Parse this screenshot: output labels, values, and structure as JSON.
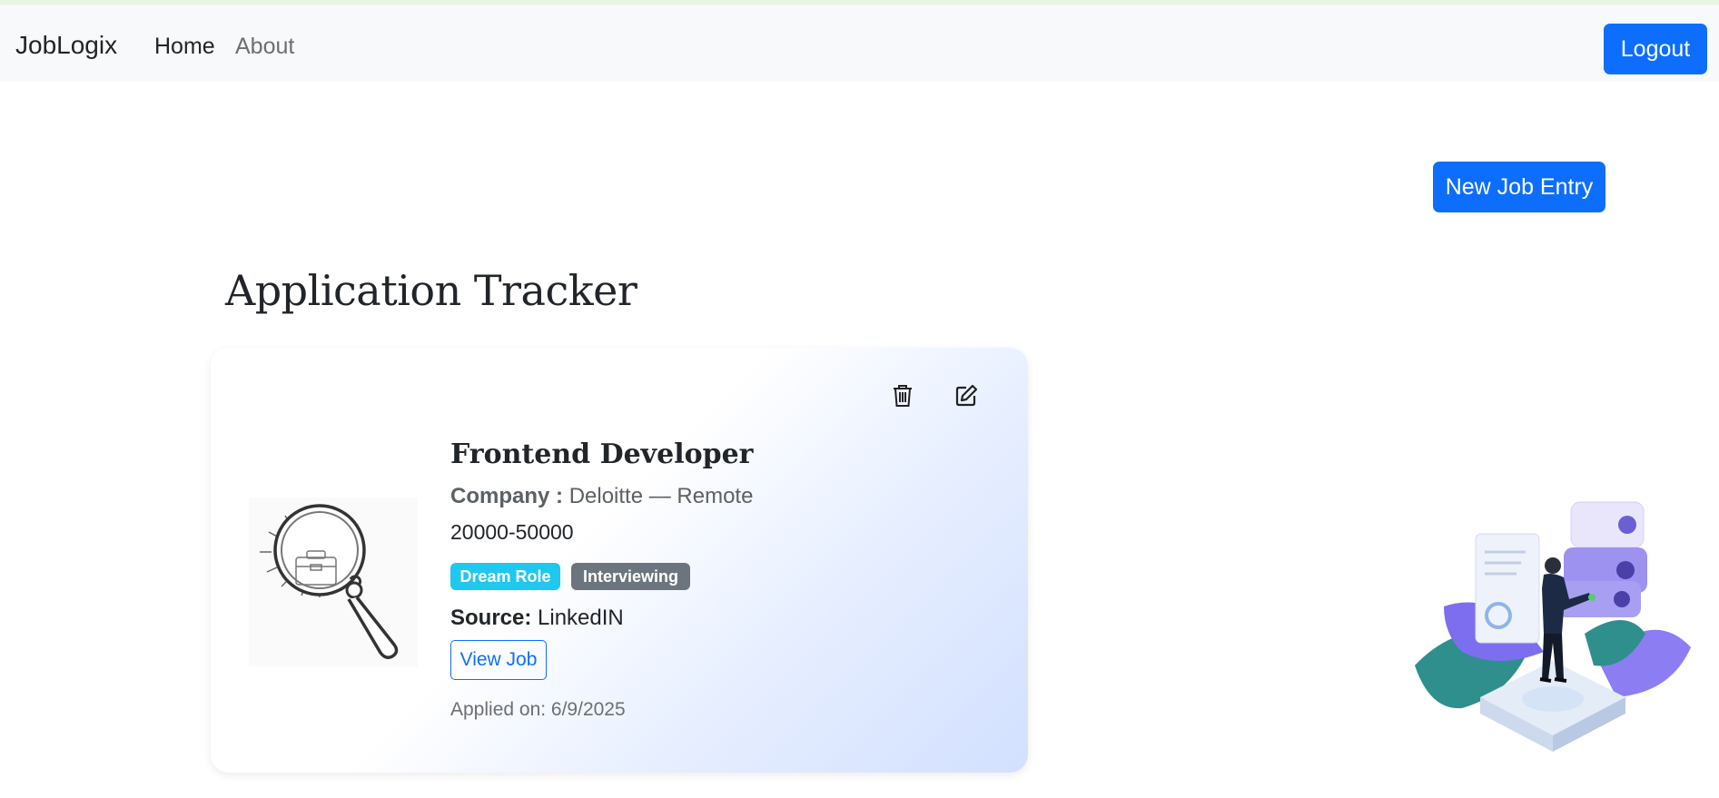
{
  "navbar": {
    "brand": "JobLogix",
    "links": [
      "Home",
      "About"
    ],
    "logout_label": "Logout"
  },
  "toolbar": {
    "new_job_label": "New Job Entry"
  },
  "page": {
    "title": "Application Tracker"
  },
  "job": {
    "title": "Frontend Developer",
    "company_label": "Company :",
    "company_value": "Deloitte — Remote",
    "salary": "20000-50000",
    "badges": [
      "Dream Role",
      "Interviewing"
    ],
    "source_label": "Source:",
    "source_value": "LinkedIN",
    "view_label": "View Job",
    "applied": "Applied on: 6/9/2025"
  },
  "colors": {
    "primary": "#0d6efd",
    "badge_dream": "#1ec8ee",
    "badge_status": "#6c757d"
  },
  "icons": [
    "trash-icon",
    "edit-icon",
    "magnifier-briefcase-logo",
    "business-illustration"
  ]
}
